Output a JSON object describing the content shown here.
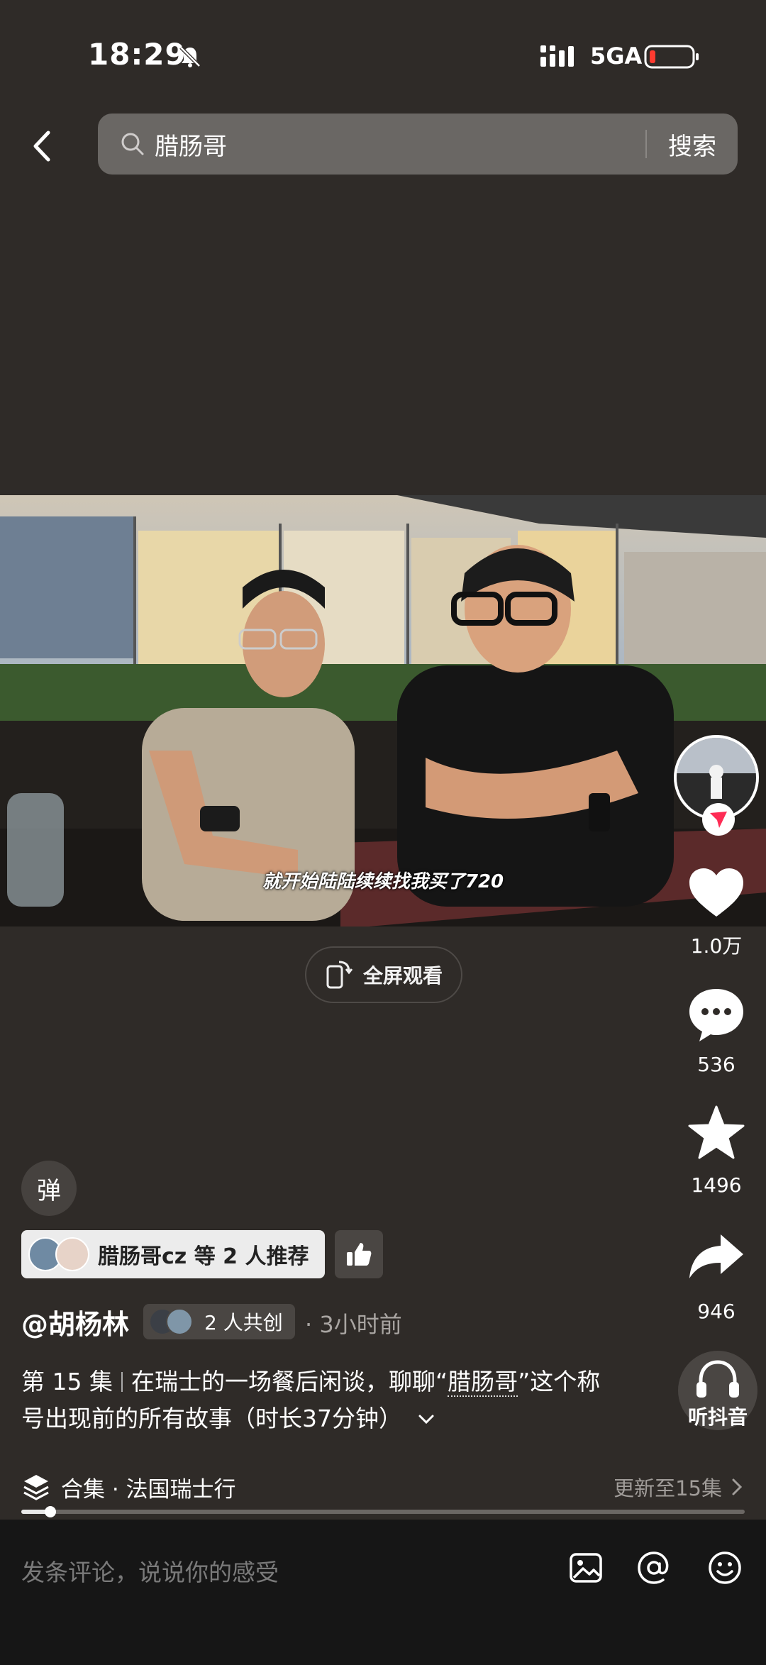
{
  "status_bar": {
    "time": "18:29",
    "network": "5GA"
  },
  "search": {
    "query": "腊肠哥",
    "button": "搜索"
  },
  "video": {
    "subtitle": "就开始陆陆续续找我买了720"
  },
  "fullscreen_label": "全屏观看",
  "actions": {
    "likes": "1.0万",
    "comments": "536",
    "favorites": "1496",
    "shares": "946",
    "listen": "听抖音"
  },
  "danmu_label": "弹",
  "recommend": {
    "text": "腊肠哥cz 等 2 人推荐"
  },
  "author": {
    "name": "@胡杨林",
    "co_create": "2 人共创",
    "time": "· 3小时前"
  },
  "description": {
    "episode": "第 15 集",
    "text_before": "在瑞士的一场餐后闲谈，聊聊“",
    "keyword": "腊肠哥",
    "text_after": "”这个称号出现前的所有故事（时长37分钟）"
  },
  "collection": {
    "title": "合集 · 法国瑞士行",
    "update": "更新至15集"
  },
  "progress": {
    "fraction": 0.04
  },
  "comment": {
    "placeholder": "发条评论，说说你的感受"
  },
  "colors": {
    "background": "#2f2b28",
    "chip": "#4a4643",
    "bottom_bar": "#161616",
    "battery_low": "#ff3b30"
  }
}
